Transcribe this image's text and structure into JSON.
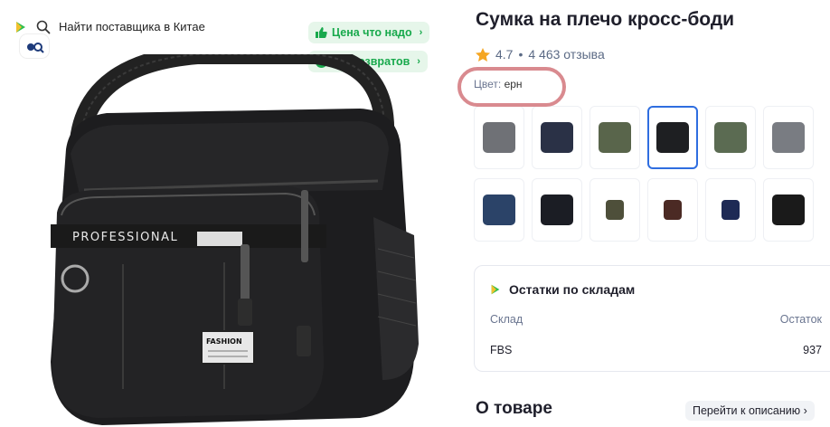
{
  "header": {
    "find_supplier": "Найти поставщика в Китае"
  },
  "badges": {
    "price": "Цена что надо",
    "returns": "0% возвратов"
  },
  "product": {
    "title": "Сумка на плечо кросс-боди",
    "rating": "4.7",
    "reviews": "4 463 отзыва",
    "color_label": "Цвет:",
    "color_value": "ерн"
  },
  "variants": [
    {
      "color": "#6f7176",
      "selected": false,
      "kind": "bag"
    },
    {
      "color": "#2a3146",
      "selected": false,
      "kind": "bag"
    },
    {
      "color": "#59654b",
      "selected": false,
      "kind": "bag"
    },
    {
      "color": "#1e1f22",
      "selected": true,
      "kind": "bag"
    },
    {
      "color": "#5b6b52",
      "selected": false,
      "kind": "bag"
    },
    {
      "color": "#797c82",
      "selected": false,
      "kind": "bag"
    },
    {
      "color": "#2b4368",
      "selected": false,
      "kind": "bag"
    },
    {
      "color": "#1b1d24",
      "selected": false,
      "kind": "bag"
    },
    {
      "color": "#4e4f3a",
      "selected": false,
      "kind": "small"
    },
    {
      "color": "#4b2a24",
      "selected": false,
      "kind": "small"
    },
    {
      "color": "#1e2a55",
      "selected": false,
      "kind": "small"
    },
    {
      "color": "#1a1a1a",
      "selected": false,
      "kind": "bag"
    }
  ],
  "stock": {
    "title": "Остатки по складам",
    "col_warehouse": "Склад",
    "col_stock": "Остаток",
    "rows": [
      {
        "warehouse": "FBS",
        "stock": "937"
      }
    ]
  },
  "about": {
    "title": "О товаре",
    "goto_description": "Перейти к описанию ›"
  },
  "bag_print": {
    "professional": "PROFESSIONAL",
    "fashion": "FASHION"
  },
  "colors": {
    "accent_green": "#18a94c",
    "selected_border": "#2f6ee0",
    "highlight": "#d98a8f",
    "star": "#f5a623"
  }
}
